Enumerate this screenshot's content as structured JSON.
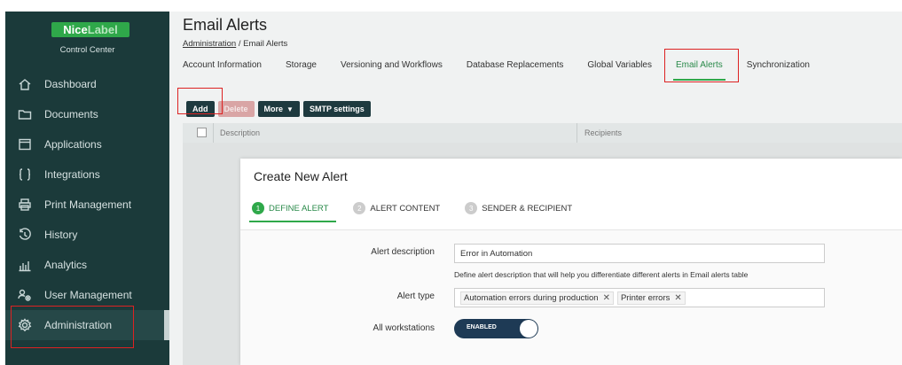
{
  "brand": {
    "name_part1": "Nice",
    "name_part2": "Label",
    "subtitle": "Control Center"
  },
  "sidebar": {
    "items": [
      {
        "label": "Dashboard",
        "icon": "home-icon"
      },
      {
        "label": "Documents",
        "icon": "folder-icon"
      },
      {
        "label": "Applications",
        "icon": "window-icon"
      },
      {
        "label": "Integrations",
        "icon": "braces-icon"
      },
      {
        "label": "Print Management",
        "icon": "printer-icon"
      },
      {
        "label": "History",
        "icon": "history-icon"
      },
      {
        "label": "Analytics",
        "icon": "bar-chart-icon"
      },
      {
        "label": "User Management",
        "icon": "users-gear-icon"
      },
      {
        "label": "Administration",
        "icon": "gear-icon",
        "active": true
      }
    ]
  },
  "header": {
    "title": "Email Alerts",
    "breadcrumb": {
      "link": "Administration",
      "separator": " / ",
      "current": "Email Alerts"
    }
  },
  "tabs": [
    {
      "label": "Account Information"
    },
    {
      "label": "Storage"
    },
    {
      "label": "Versioning and Workflows"
    },
    {
      "label": "Database Replacements"
    },
    {
      "label": "Global Variables"
    },
    {
      "label": "Email Alerts",
      "active": true
    },
    {
      "label": "Synchronization"
    }
  ],
  "toolbar": {
    "add": "Add",
    "delete": "Delete",
    "more": "More",
    "more_caret": "▼",
    "smtp": "SMTP settings"
  },
  "grid": {
    "columns": [
      "Description",
      "Recipients"
    ]
  },
  "modal": {
    "title": "Create New Alert",
    "steps": [
      {
        "num": "1",
        "label": "DEFINE ALERT",
        "active": true
      },
      {
        "num": "2",
        "label": "ALERT CONTENT"
      },
      {
        "num": "3",
        "label": "SENDER & RECIPIENT"
      }
    ],
    "form": {
      "description_label": "Alert description",
      "description_value": "Error in Automation",
      "description_hint": "Define alert description that will help you differentiate different alerts in Email alerts table",
      "type_label": "Alert type",
      "type_chips": [
        "Automation errors during production",
        "Printer errors"
      ],
      "chip_remove": "✕",
      "workstations_label": "All workstations",
      "toggle_text": "ENABLED",
      "toggle_state": "on"
    }
  },
  "colors": {
    "sidebar_bg": "#1b3a3a",
    "accent_green": "#2fa84a",
    "button_dark": "#1e3a3f",
    "highlight_red": "#dd2222"
  }
}
